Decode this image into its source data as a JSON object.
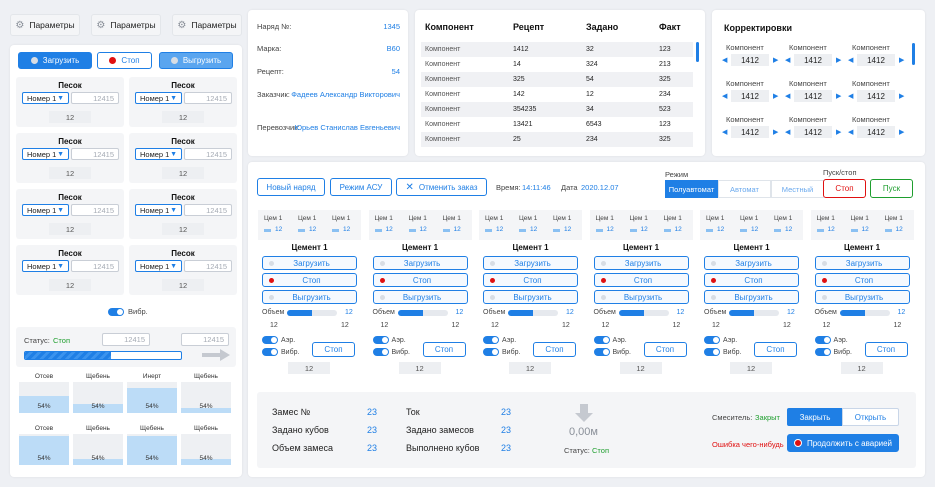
{
  "params_tabs": [
    {
      "label": "Параметры"
    },
    {
      "label": "Параметры"
    },
    {
      "label": "Параметры"
    }
  ],
  "left_actions": {
    "load": "Загрузить",
    "stop": "Стоп",
    "unload": "Выгрузить"
  },
  "bunkers": [
    {
      "title": "Песок",
      "select": "Номер 1",
      "input": "12415",
      "value": "12"
    },
    {
      "title": "Песок",
      "select": "Номер 1",
      "input": "12415",
      "value": "12"
    },
    {
      "title": "Песок",
      "select": "Номер 1",
      "input": "12415",
      "value": "12"
    },
    {
      "title": "Песок",
      "select": "Номер 1",
      "input": "12415",
      "value": "12"
    },
    {
      "title": "Песок",
      "select": "Номер 1",
      "input": "12415",
      "value": "12"
    },
    {
      "title": "Песок",
      "select": "Номер 1",
      "input": "12415",
      "value": "12"
    },
    {
      "title": "Песок",
      "select": "Номер 1",
      "input": "12415",
      "value": "12"
    },
    {
      "title": "Песок",
      "select": "Номер 1",
      "input": "12415",
      "value": "12"
    }
  ],
  "vibr_label": "Вибр.",
  "status": {
    "label": "Статус:",
    "value": "Стоп",
    "input1": "12415",
    "input2": "12415",
    "progress": 0.55
  },
  "silos": [
    {
      "name": "Отсев",
      "pct": "54%",
      "fill": 0.54
    },
    {
      "name": "Щебень",
      "pct": "54%",
      "fill": 0.3
    },
    {
      "name": "Инерт",
      "pct": "54%",
      "fill": 0.8
    },
    {
      "name": "Щебень",
      "pct": "54%",
      "fill": 0.15
    },
    {
      "name": "Отсев",
      "pct": "54%",
      "fill": 0.95
    },
    {
      "name": "Щебень",
      "pct": "54%",
      "fill": 0.2
    },
    {
      "name": "Щебень",
      "pct": "54%",
      "fill": 0.95
    },
    {
      "name": "Щебень",
      "pct": "54%",
      "fill": 0.2
    }
  ],
  "order": {
    "rows": [
      {
        "label": "Наряд №:",
        "value": "1345"
      },
      {
        "label": "Марка:",
        "value": "B60"
      },
      {
        "label": "Рецепт:",
        "value": "54"
      },
      {
        "label": "Заказчик:",
        "value": "Фадеев Александр Викторович"
      },
      {
        "label": "Перевозчик:",
        "value": "Юрьев Станислав Евгеньевич"
      }
    ]
  },
  "components": {
    "headers": [
      "Компонент",
      "Рецепт",
      "Задано",
      "Факт"
    ],
    "rows": [
      [
        "Компонент",
        "1412",
        "32",
        "123"
      ],
      [
        "Компонент",
        "14",
        "324",
        "213"
      ],
      [
        "Компонент",
        "325",
        "54",
        "325"
      ],
      [
        "Компонент",
        "142",
        "12",
        "234"
      ],
      [
        "Компонент",
        "354235",
        "34",
        "523"
      ],
      [
        "Компонент",
        "13421",
        "6543",
        "123"
      ],
      [
        "Компонент",
        "25",
        "234",
        "325"
      ]
    ]
  },
  "corrections": {
    "title": "Корректировки",
    "items": [
      {
        "label": "Компонент",
        "value": "1412"
      },
      {
        "label": "Компонент",
        "value": "1412"
      },
      {
        "label": "Компонент",
        "value": "1412"
      },
      {
        "label": "Компонент",
        "value": "1412"
      },
      {
        "label": "Компонент",
        "value": "1412"
      },
      {
        "label": "Компонент",
        "value": "1412"
      },
      {
        "label": "Компонент",
        "value": "1412"
      },
      {
        "label": "Компонент",
        "value": "1412"
      },
      {
        "label": "Компонент",
        "value": "1412"
      }
    ]
  },
  "toolbar": {
    "new_order": "Новый наряд",
    "asu_mode": "Режим АСУ",
    "cancel_order": "Отменить заказ",
    "time_label": "Время:",
    "time": "14:11:46",
    "date_label": "Дата",
    "date": "2020.12.07"
  },
  "mode": {
    "label": "Режим",
    "options": [
      "Полуавтомат",
      "Автомат",
      "Местный"
    ],
    "active": 0
  },
  "start_stop": {
    "label": "Пуск/стоп",
    "stop": "Стоп",
    "start": "Пуск"
  },
  "cement": {
    "col_labels": [
      "Цем 1",
      "Цем 1",
      "Цем 1"
    ],
    "title": "Цемент 1",
    "load": "Загрузить",
    "stop": "Стоп",
    "unload": "Выгрузить",
    "volume_label": "Объем",
    "volume_value": "12",
    "volume_fill": 0.5,
    "value_a": "12",
    "value_b": "12",
    "aer": "Аэр.",
    "vibr": "Вибр.",
    "stop_btn": "Стоп",
    "bottom": "12"
  },
  "cement_count": 6,
  "summary": {
    "left": [
      {
        "label": "Замес №",
        "value": "23"
      },
      {
        "label": "Задано кубов",
        "value": "23"
      },
      {
        "label": "Объем замеса",
        "value": "23"
      }
    ],
    "mid": [
      {
        "label": "Ток",
        "value": "23"
      },
      {
        "label": "Задано замесов",
        "value": "23"
      },
      {
        "label": "Выполнено кубов",
        "value": "23"
      }
    ],
    "meter": "0,00м",
    "status_label": "Статус:",
    "status_value": "Стоп",
    "mixer_label": "Смеситель:",
    "mixer_value": "Закрыт",
    "close": "Закрыть",
    "open": "Открыть",
    "error": "Ошибка чего-нибудь",
    "continue": "Продолжить с аварией"
  },
  "colors": {
    "accent": "#1f7fe5",
    "danger": "#e01010",
    "ok": "#1e9e2e"
  }
}
